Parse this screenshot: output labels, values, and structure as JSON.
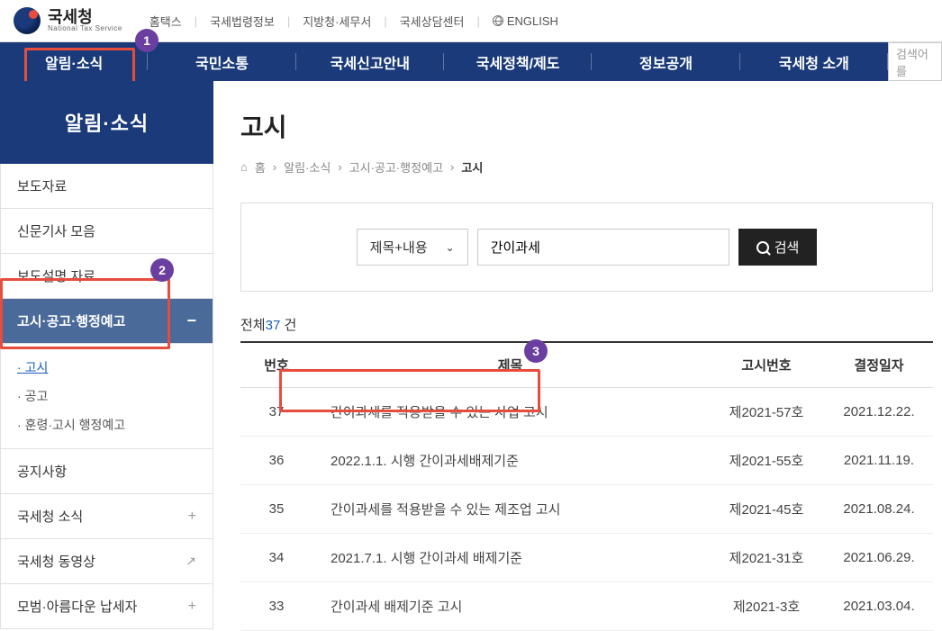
{
  "header": {
    "logo_ko": "국세청",
    "logo_en": "National Tax Service",
    "top_links": [
      "홈택스",
      "국세법령정보",
      "지방청·세무서",
      "국세상담센터",
      "ENGLISH"
    ]
  },
  "nav": {
    "items": [
      "알림·소식",
      "국민소통",
      "국세신고안내",
      "국세정책/제도",
      "정보공개",
      "국세청 소개"
    ],
    "search_placeholder": "검색어를"
  },
  "sidebar": {
    "title": "알림·소식",
    "items": [
      {
        "label": "보도자료",
        "type": "plain"
      },
      {
        "label": "신문기사 모음",
        "type": "plain"
      },
      {
        "label": "보도설명 자료",
        "type": "plain"
      },
      {
        "label": "고시·공고·행정예고",
        "type": "active",
        "sub": [
          {
            "label": "고시",
            "current": true
          },
          {
            "label": "공고"
          },
          {
            "label": "훈령·고시 행정예고"
          }
        ]
      },
      {
        "label": "공지사항",
        "type": "plain"
      },
      {
        "label": "국세청 소식",
        "type": "expand"
      },
      {
        "label": "국세청 동영상",
        "type": "ext"
      },
      {
        "label": "모범·아름다운 납세자",
        "type": "expand"
      }
    ]
  },
  "content": {
    "page_title": "고시",
    "breadcrumb": [
      "홈",
      "알림·소식",
      "고시·공고·행정예고",
      "고시"
    ],
    "search": {
      "select_label": "제목+내용",
      "input_value": "간이과세",
      "button_label": "검색"
    },
    "total_prefix": "전체",
    "total_count": "37",
    "total_suffix": " 건",
    "columns": [
      "번호",
      "제목",
      "고시번호",
      "결정일자"
    ],
    "rows": [
      {
        "no": "37",
        "title": "간이과세를 적용받을 수 있는 사업 고시",
        "code": "제2021-57호",
        "date": "2021.12.22."
      },
      {
        "no": "36",
        "title": "2022.1.1. 시행 간이과세배제기준",
        "code": "제2021-55호",
        "date": "2021.11.19."
      },
      {
        "no": "35",
        "title": "간이과세를 적용받을 수 있는 제조업 고시",
        "code": "제2021-45호",
        "date": "2021.08.24."
      },
      {
        "no": "34",
        "title": "2021.7.1. 시행 간이과세 배제기준",
        "code": "제2021-31호",
        "date": "2021.06.29."
      },
      {
        "no": "33",
        "title": "간이과세 배제기준 고시",
        "code": "제2021-3호",
        "date": "2021.03.04."
      }
    ]
  },
  "annotations": {
    "n1": "1",
    "n2": "2",
    "n3": "3"
  }
}
